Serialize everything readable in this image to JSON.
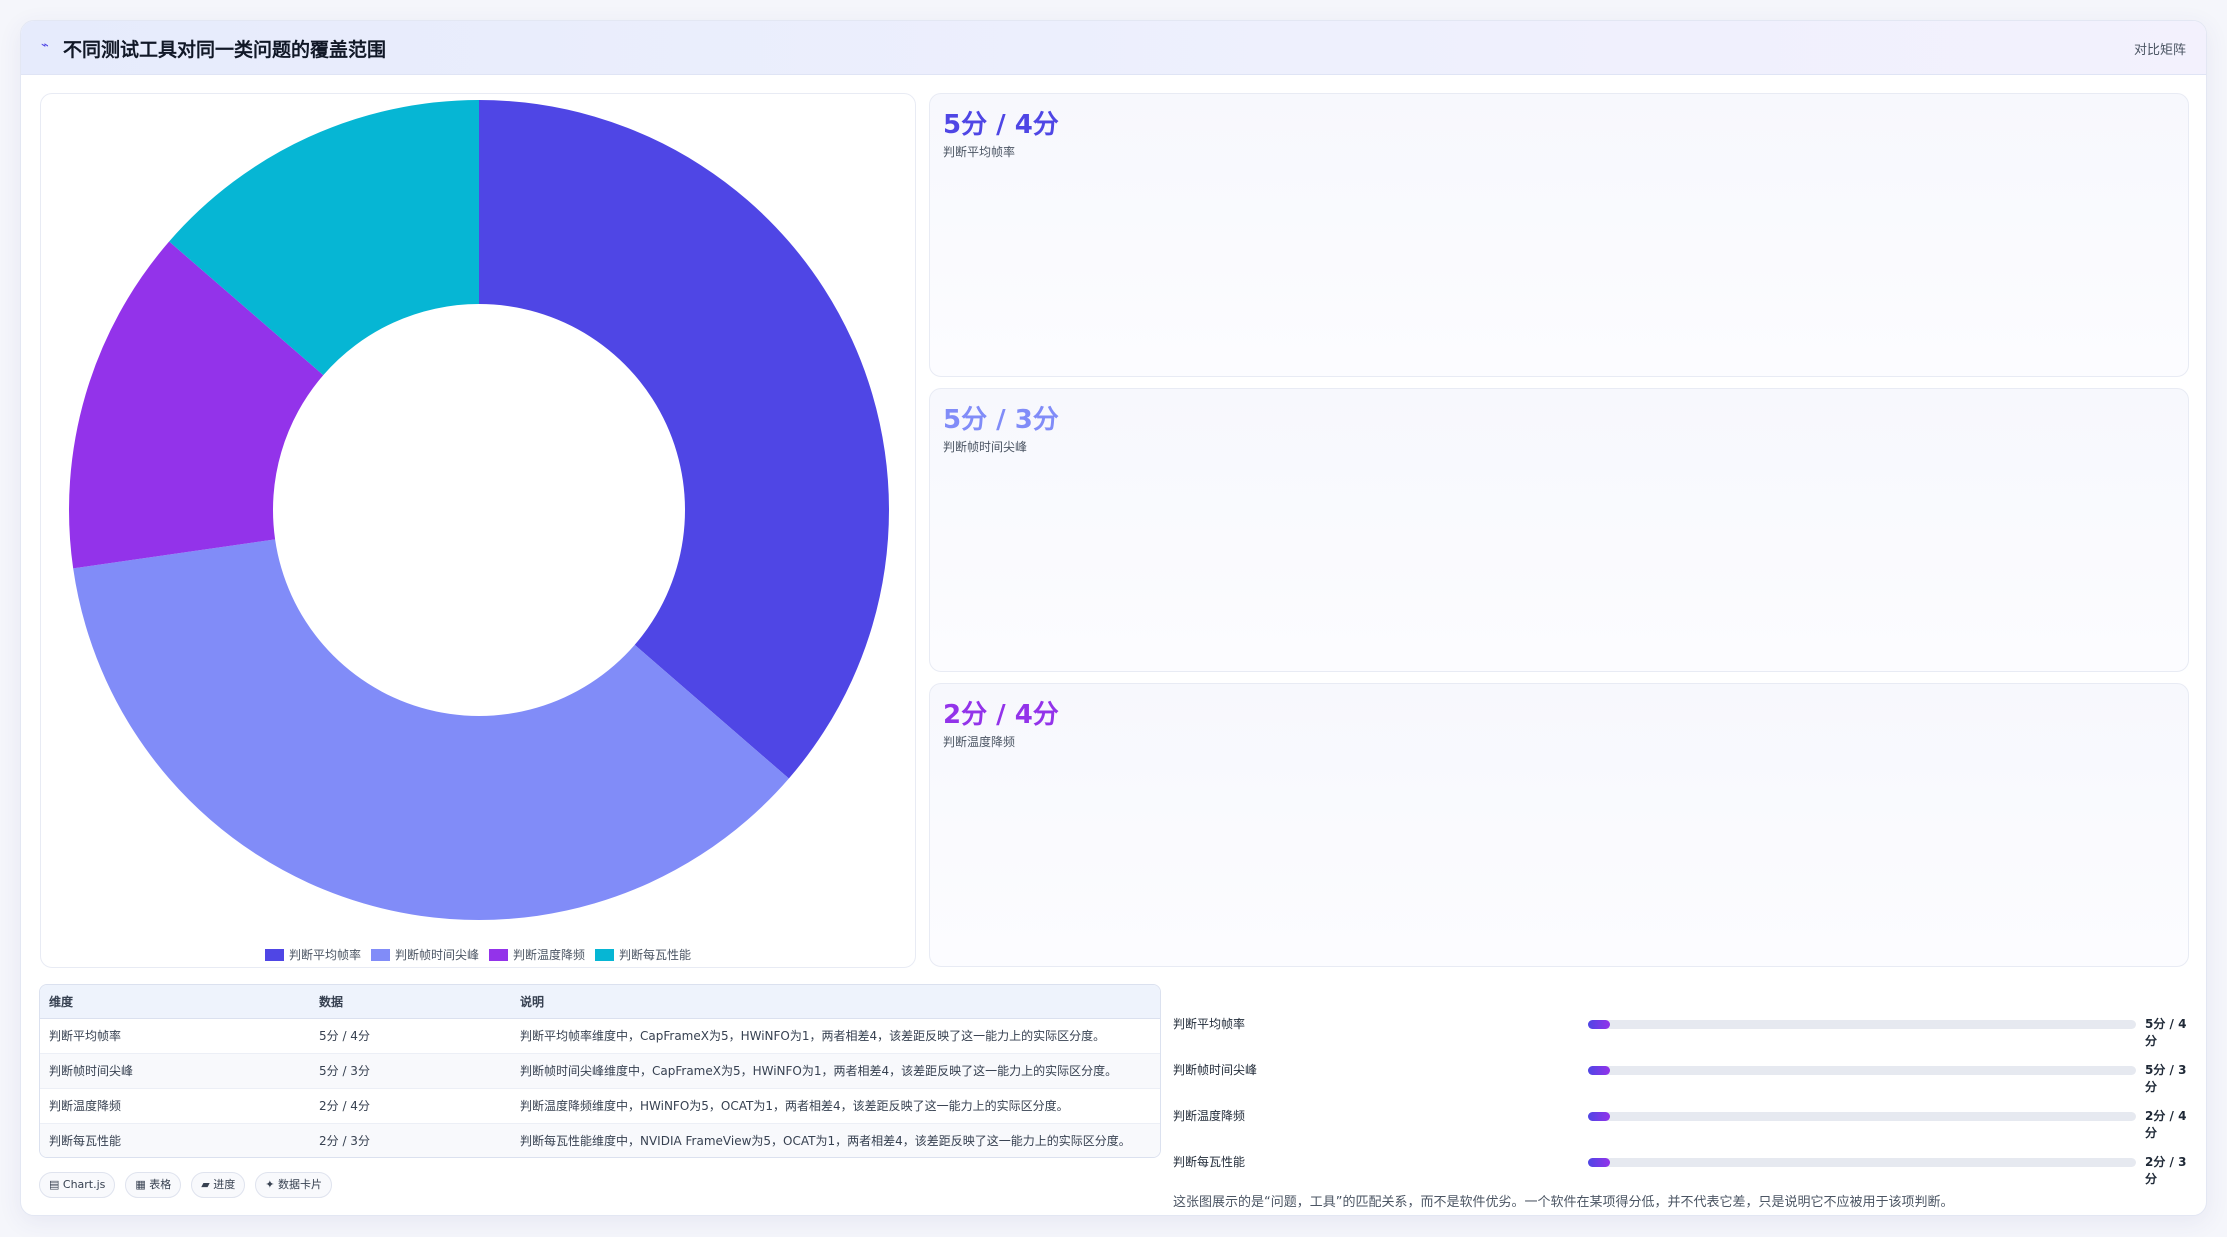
{
  "header": {
    "icon": "trend-icon",
    "title": "不同测试工具对同一类问题的覆盖范围",
    "badge": "对比矩阵"
  },
  "chart_data": {
    "type": "pie",
    "donut": true,
    "categories": [
      "判断平均帧率",
      "判断帧时间尖峰",
      "判断温度降频",
      "判断每瓦性能"
    ],
    "values": [
      4,
      4,
      1.5,
      1.5
    ],
    "colors": [
      "#4f46e5",
      "#818cf8",
      "#9333ea",
      "#06b6d4"
    ],
    "legend_position": "bottom"
  },
  "stats": [
    {
      "value": "5分 / 4分",
      "label": "判断平均帧率",
      "color": "#4f46e5"
    },
    {
      "value": "5分 / 3分",
      "label": "判断帧时间尖峰",
      "color": "#818cf8"
    },
    {
      "value": "2分 / 4分",
      "label": "判断温度降频",
      "color": "#9333ea"
    }
  ],
  "table": {
    "headers": [
      "维度",
      "数据",
      "说明"
    ],
    "rows": [
      [
        "判断平均帧率",
        "5分 / 4分",
        "判断平均帧率维度中，CapFrameX为5，HWiNFO为1，两者相差4，该差距反映了这一能力上的实际区分度。"
      ],
      [
        "判断帧时间尖峰",
        "5分 / 3分",
        "判断帧时间尖峰维度中，CapFrameX为5，HWiNFO为1，两者相差4，该差距反映了这一能力上的实际区分度。"
      ],
      [
        "判断温度降频",
        "2分 / 4分",
        "判断温度降频维度中，HWiNFO为5，OCAT为1，两者相差4，该差距反映了这一能力上的实际区分度。"
      ],
      [
        "判断每瓦性能",
        "2分 / 3分",
        "判断每瓦性能维度中，NVIDIA FrameView为5，OCAT为1，两者相差4，该差距反映了这一能力上的实际区分度。"
      ]
    ]
  },
  "tags": [
    "▤ Chart.js",
    "▦ 表格",
    "▰ 进度",
    "✦ 数据卡片"
  ],
  "progress": [
    {
      "label": "判断平均帧率",
      "value": "5分 / 4分",
      "fraction": 0.04
    },
    {
      "label": "判断帧时间尖峰",
      "value": "5分 / 3分",
      "fraction": 0.04
    },
    {
      "label": "判断温度降频",
      "value": "2分 / 4分",
      "fraction": 0.04
    },
    {
      "label": "判断每瓦性能",
      "value": "2分 / 3分",
      "fraction": 0.04
    }
  ],
  "note": "这张图展示的是“问题，工具”的匹配关系，而不是软件优劣。一个软件在某项得分低，并不代表它差，只是说明它不应被用于该项判断。"
}
